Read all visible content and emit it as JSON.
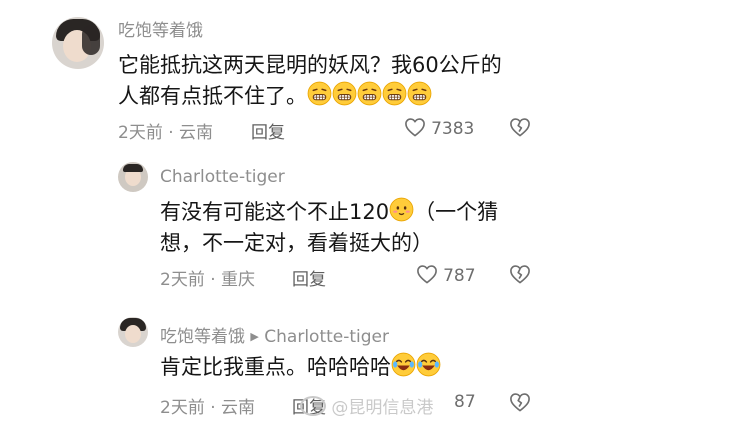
{
  "comments": [
    {
      "user": "吃饱等着饿",
      "text_line1": "它能抵抗这两天昆明的妖风？我60公斤的",
      "text_line2": "人都有点抵不住了。",
      "trailing_emoji": [
        "grimace-emoji",
        "grimace-emoji",
        "grimace-emoji",
        "grimace-emoji",
        "grimace-emoji"
      ],
      "time": "2天前",
      "location": "云南",
      "reply_label": "回复",
      "likes": "7383"
    },
    {
      "user": "Charlotte-tiger",
      "text_line1_a": "有没有可能这个不止120",
      "text_line1_b": "（一个猜",
      "text_line2": "想，不一定对，看着挺大的）",
      "inline_emoji": "blushing-emoji",
      "time": "2天前",
      "location": "重庆",
      "reply_label": "回复",
      "likes": "787"
    },
    {
      "user": "吃饱等着饿",
      "reply_to": "Charlotte-tiger",
      "text": "肯定比我重点。哈哈哈哈",
      "trailing_emoji": [
        "laughing-emoji",
        "laughing-emoji"
      ],
      "time": "2天前",
      "location": "云南",
      "reply_label": "回复",
      "likes": "87"
    }
  ],
  "separator": "·",
  "watermark": "@昆明信息港",
  "colors": {
    "text": "#161616",
    "meta": "#8e8e8e",
    "icon": "#6e6e6e"
  }
}
